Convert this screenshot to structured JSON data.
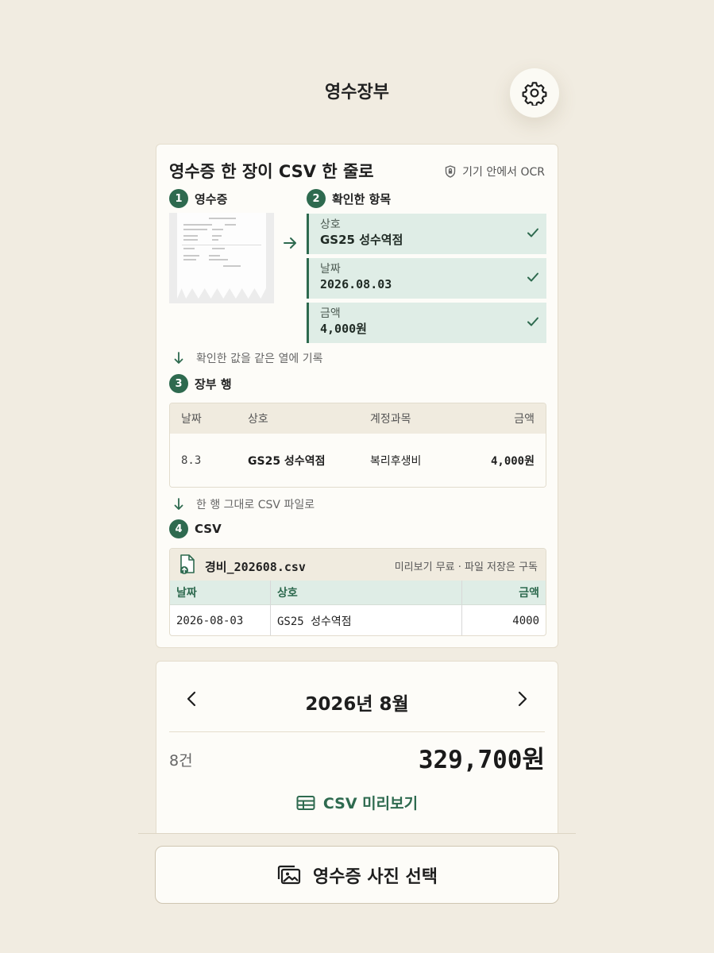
{
  "header": {
    "title": "영수장부"
  },
  "guide": {
    "title": "영수증 한 장이 CSV 한 줄로",
    "ocr_badge": "기기 안에서 OCR",
    "steps": [
      {
        "num": "1",
        "label": "영수증"
      },
      {
        "num": "2",
        "label": "확인한 항목"
      },
      {
        "num": "3",
        "label": "장부 행"
      },
      {
        "num": "4",
        "label": "CSV"
      }
    ],
    "fields": [
      {
        "label": "상호",
        "value": "GS25 성수역점"
      },
      {
        "label": "날짜",
        "value": "2026.08.03"
      },
      {
        "label": "금액",
        "value": "4,000원"
      }
    ],
    "hint_record": "확인한 값을 같은 열에 기록",
    "hint_csv": "한 행 그대로 CSV 파일로",
    "ledger": {
      "headers": [
        "날짜",
        "상호",
        "계정과목",
        "금액"
      ],
      "row": [
        "8.3",
        "GS25 성수역점",
        "복리후생비",
        "4,000원"
      ]
    },
    "csv": {
      "filename": "경비_202608.csv",
      "note": "미리보기 무료 · 파일 저장은 구독",
      "headers": [
        "날짜",
        "상호",
        "금액"
      ],
      "row": [
        "2026-08-03",
        "GS25 성수역점",
        "4000"
      ]
    }
  },
  "month": {
    "label": "2026년 8월",
    "count": "8건",
    "total": "329,700원",
    "csv_preview": "CSV 미리보기"
  },
  "select_button": {
    "label": "영수증 사진 선택"
  },
  "colors": {
    "accent": "#2e6a4f",
    "background": "#f1ece1",
    "field_bg": "#dfede6"
  }
}
